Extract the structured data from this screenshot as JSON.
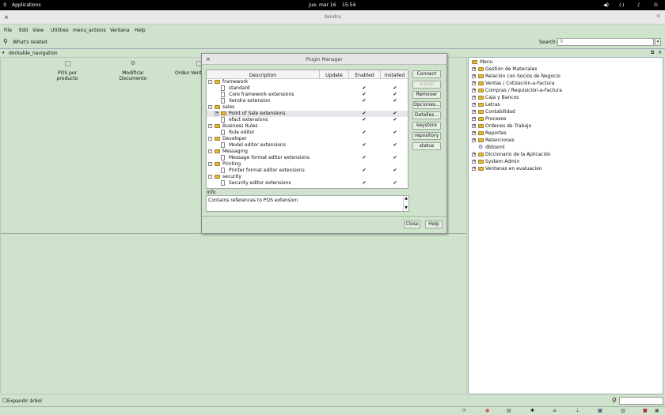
{
  "topbar": {
    "applications": "Applications",
    "date": "jue, mar 16",
    "time": "15:54"
  },
  "window": {
    "title": "Xendra"
  },
  "menu": [
    "File",
    "Edit",
    "View",
    "Utilities",
    "menu_actions",
    "Ventana",
    "Help"
  ],
  "toolbar": {
    "whats_related": "What's related",
    "search_label": "Search:",
    "search_value": ""
  },
  "dock": {
    "header": "dockable_navigation",
    "shortcuts": [
      "POS por producto",
      "Modificar Documento",
      "Orden Venta"
    ]
  },
  "dialog": {
    "title": "Plugin Manager",
    "columns": [
      "Description",
      "Update",
      "Enabled",
      "Installed"
    ],
    "rows": [
      {
        "label": "framework",
        "level": 0,
        "type": "folder",
        "expander": "-",
        "enabled": "",
        "installed": ""
      },
      {
        "label": "standard",
        "level": 1,
        "type": "doc",
        "expander": "",
        "enabled": "✔",
        "installed": "✔"
      },
      {
        "label": "Core framework extensions",
        "level": 1,
        "type": "doc",
        "expander": "",
        "enabled": "✔",
        "installed": "✔"
      },
      {
        "label": "Xendra extension",
        "level": 1,
        "type": "doc",
        "expander": "",
        "enabled": "✔",
        "installed": "✔"
      },
      {
        "label": "sales",
        "level": 0,
        "type": "folder",
        "expander": "-",
        "enabled": "",
        "installed": ""
      },
      {
        "label": "Point of Sale extensions",
        "level": 1,
        "type": "folder",
        "expander": "+",
        "enabled": "✔",
        "installed": "✔",
        "selected": true
      },
      {
        "label": "efact extensions",
        "level": 1,
        "type": "doc",
        "expander": "",
        "enabled": "✔",
        "installed": "✔"
      },
      {
        "label": "Business Rules",
        "level": 0,
        "type": "folder",
        "expander": "-",
        "enabled": "",
        "installed": ""
      },
      {
        "label": "Rule editor",
        "level": 1,
        "type": "doc",
        "expander": "",
        "enabled": "✔",
        "installed": "✔"
      },
      {
        "label": "Developer",
        "level": 0,
        "type": "folder",
        "expander": "-",
        "enabled": "",
        "installed": ""
      },
      {
        "label": "Model editor extensions",
        "level": 1,
        "type": "doc",
        "expander": "",
        "enabled": "✔",
        "installed": "✔"
      },
      {
        "label": "Messaging",
        "level": 0,
        "type": "folder",
        "expander": "-",
        "enabled": "",
        "installed": ""
      },
      {
        "label": "Message format editor extensions",
        "level": 1,
        "type": "doc",
        "expander": "",
        "enabled": "✔",
        "installed": "✔"
      },
      {
        "label": "Printing",
        "level": 0,
        "type": "folder",
        "expander": "-",
        "enabled": "",
        "installed": ""
      },
      {
        "label": "Printer format editor extensions",
        "level": 1,
        "type": "doc",
        "expander": "",
        "enabled": "✔",
        "installed": "✔"
      },
      {
        "label": "security",
        "level": 0,
        "type": "folder",
        "expander": "-",
        "enabled": "",
        "installed": ""
      },
      {
        "label": "Security editor extensions",
        "level": 1,
        "type": "doc",
        "expander": "",
        "enabled": "✔",
        "installed": "✔"
      }
    ],
    "buttons": [
      {
        "label": "Connect",
        "disabled": false
      },
      {
        "label": "Install",
        "disabled": true
      },
      {
        "label": "Remover",
        "disabled": false
      },
      {
        "label": "Opciones...",
        "disabled": false
      },
      {
        "label": "Detalles...",
        "disabled": false
      },
      {
        "label": "keystore",
        "disabled": false
      },
      {
        "label": "repository",
        "disabled": false
      },
      {
        "label": "status",
        "disabled": false
      }
    ],
    "info_label": "Info",
    "info_text": "Contains references to POS extension",
    "close_label": "Close",
    "help_label": "Help"
  },
  "menu_tree": {
    "root": "Menu",
    "items": [
      {
        "label": "Gestión de Materiales",
        "type": "folder"
      },
      {
        "label": "Relación con Socios de Negocio",
        "type": "folder"
      },
      {
        "label": "Ventas / Cotización-a-Factura",
        "type": "folder"
      },
      {
        "label": "Compras / Requisición-a-Factura",
        "type": "folder"
      },
      {
        "label": "Caja y Bancos",
        "type": "folder"
      },
      {
        "label": "Letras",
        "type": "folder"
      },
      {
        "label": "Contabilidad",
        "type": "folder"
      },
      {
        "label": "Procesos",
        "type": "folder"
      },
      {
        "label": "Ordenes de Trabajo",
        "type": "folder"
      },
      {
        "label": "Reportes",
        "type": "folder"
      },
      {
        "label": "Retenciones",
        "type": "folder"
      },
      {
        "label": "dbtoxml",
        "type": "leaf"
      },
      {
        "label": "Diccionario de la Aplicación",
        "type": "folder"
      },
      {
        "label": "System Admin",
        "type": "folder"
      },
      {
        "label": "Ventanas en evaluacion",
        "type": "folder"
      }
    ]
  },
  "status": {
    "expand_tree": "Expandir árbol"
  },
  "colors": {
    "background": "#cfe3cc",
    "folder": "#e6b93c"
  }
}
